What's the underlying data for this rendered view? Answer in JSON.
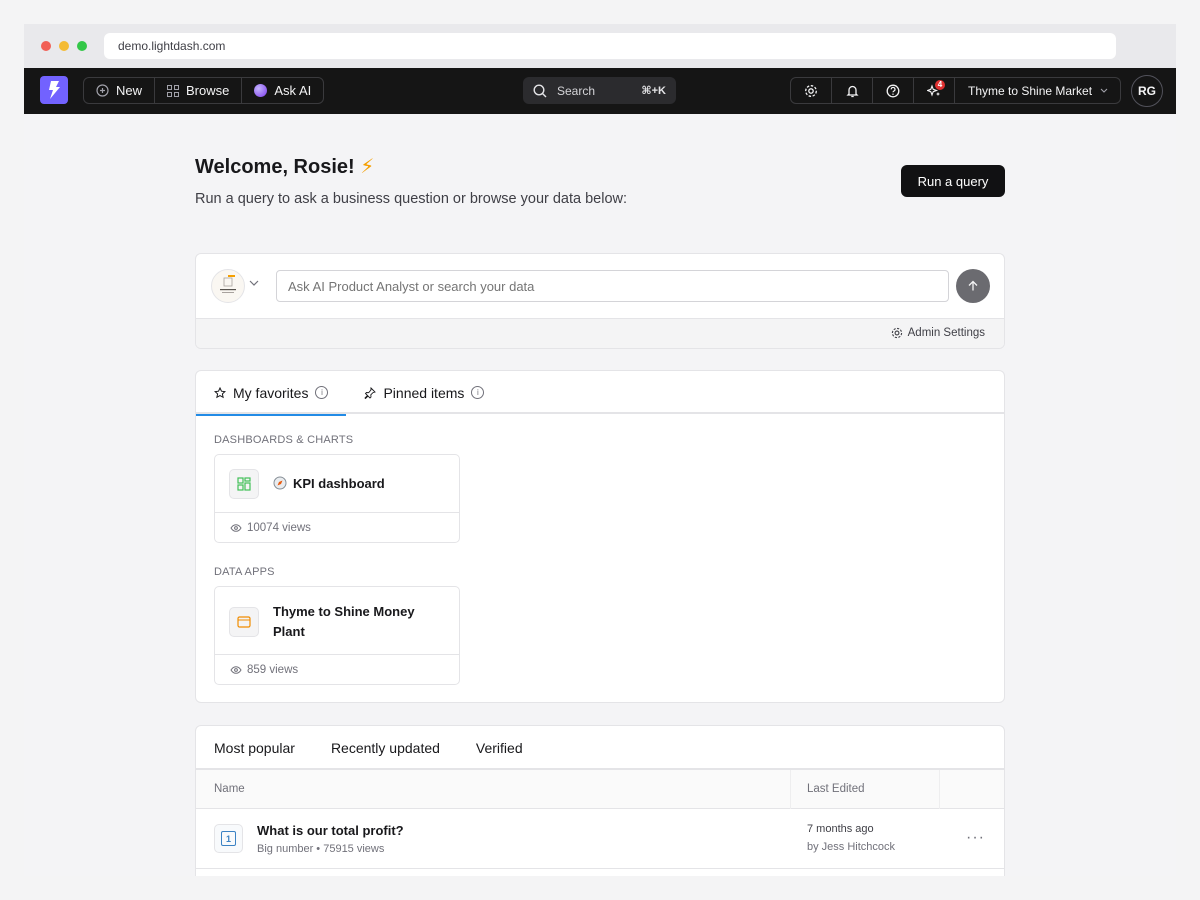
{
  "browser": {
    "url": "demo.lightdash.com"
  },
  "topnav": {
    "new_label": "New",
    "browse_label": "Browse",
    "ask_ai_label": "Ask AI",
    "search_label": "Search",
    "search_shortcut": "⌘+K",
    "notification_count": "4",
    "project_name": "Thyme to Shine Market",
    "avatar_initials": "RG"
  },
  "header": {
    "welcome": "Welcome, Rosie!",
    "welcome_emoji": "⚡",
    "subtitle": "Run a query to ask a business question or browse your data below:",
    "run_query_label": "Run a query"
  },
  "ask_box": {
    "placeholder": "Ask AI Product Analyst or search your data",
    "admin_settings_label": "Admin Settings"
  },
  "favorites": {
    "tabs": [
      {
        "label": "My favorites",
        "active": true
      },
      {
        "label": "Pinned items",
        "active": false
      }
    ],
    "sections": [
      {
        "label": "DASHBOARDS & CHARTS",
        "items": [
          {
            "title": "KPI dashboard",
            "views": "10074 views"
          }
        ]
      },
      {
        "label": "DATA APPS",
        "items": [
          {
            "title": "Thyme to Shine Money Plant",
            "views": "859 views"
          }
        ]
      }
    ]
  },
  "popular": {
    "tabs": [
      {
        "label": "Most popular",
        "active": true
      },
      {
        "label": "Recently updated",
        "active": false
      },
      {
        "label": "Verified",
        "active": false
      }
    ],
    "columns": {
      "name": "Name",
      "last_edited": "Last Edited"
    },
    "rows": [
      {
        "title": "What is our total profit?",
        "meta": "Big number • 75915 views",
        "edited": "7 months ago",
        "by": "by Jess Hitchcock",
        "icon_text": "1"
      }
    ]
  },
  "colors": {
    "brand": "#7262ff",
    "nav_bg": "#151515",
    "active_tab": "#228be6",
    "badge": "#e03131"
  }
}
